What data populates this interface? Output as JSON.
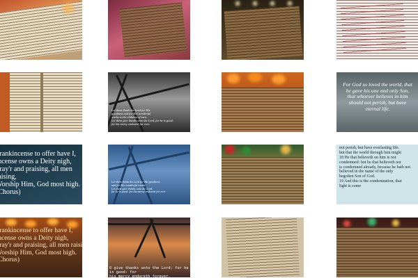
{
  "tiles": {
    "t5_text": "Let them thank the Lord for His\ngoodness and for His wonderful\nworks to the children of men.\nLet them give thanks unto the Lord, for he is good:\nfor his mercy endureth for ever.",
    "t8_text": "For God so loved the world, that\nhe gave his one and only Son,\nthat whoever believes in him\nshould not perish, but have\neternal life.",
    "t9_text": "Frankincense to offer have I,\nIncense owns a Deity nigh,\nPray'r and praising, all men raising,\nWorship Him, God most high.\n(Chorus)",
    "t10_text": "Let them thank the Lord for His goodness\nand for His wonderful works.\nLet them give thanks unto the Lord,\nfor he is good: for his mercy endureth for ever.",
    "t12_text": "not perish, but have everlasting life.\nbut that the world through him might\n18 He that believeth on him is not\ncondemned: but he that believeth not\nis condemned already, because he hath not\nbelieved in the name of the only\nbegotten Son of God.\n19 And this is the condemnation, that\nlight is come",
    "t13_text": "Frankincense to offer have I,\nIncense owns a Deity nigh,\nPray'r and praising, all men raising,\nWorship Him, God most high.\n(Chorus)",
    "t14_text": "O give thanks unto the Lord; for he is good: for\nhis mercy endureth forever."
  },
  "colors": {
    "frame": "#1a1a1a",
    "sky_blue": "#3f6ea6",
    "warm_orange": "#d9772a"
  }
}
